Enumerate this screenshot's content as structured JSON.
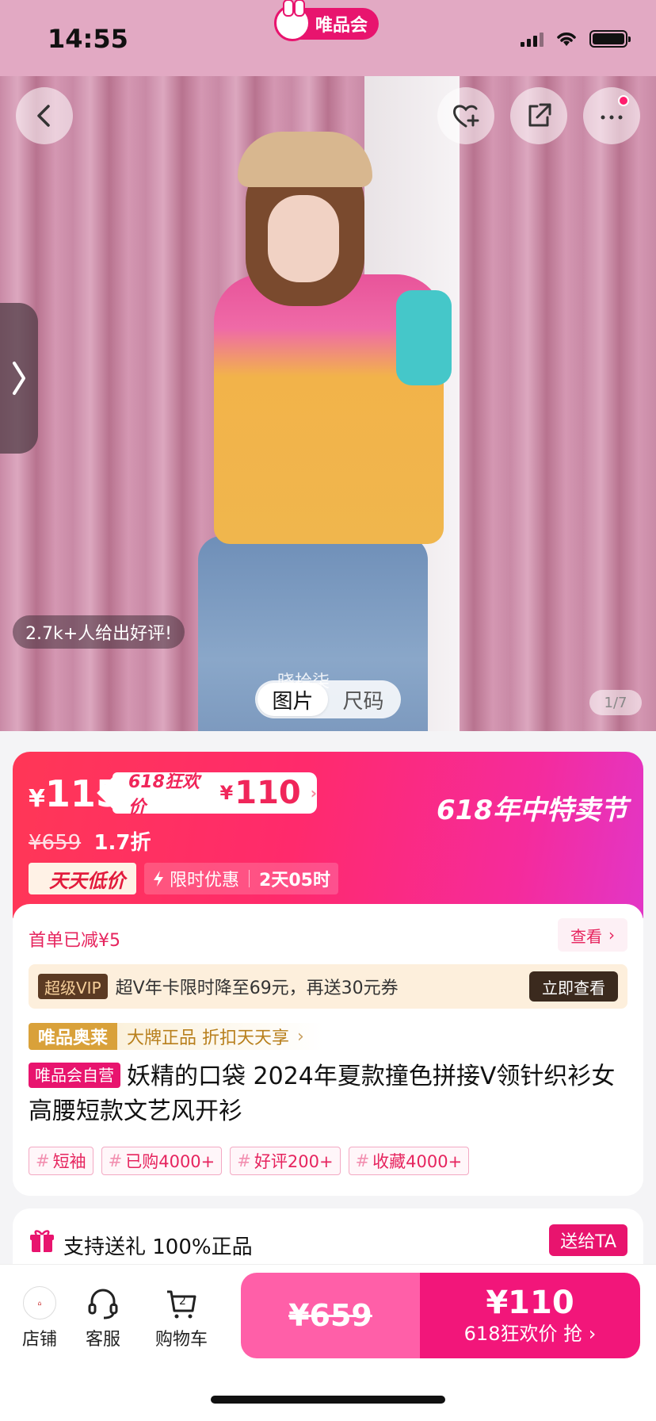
{
  "status": {
    "time": "14:55",
    "brand": "唯品会"
  },
  "hero": {
    "review": "2.7k+人给出好评!",
    "overlay": "晓拾柒",
    "tabs": [
      {
        "label": "图片"
      },
      {
        "label": "尺码"
      }
    ],
    "counter": "1/7"
  },
  "price": {
    "yen": "¥",
    "current": "115",
    "promo_label": "618狂欢价",
    "promo_yen": "¥",
    "promo_value": "110",
    "festival": "618年中特卖节",
    "original": "¥659",
    "discount": "1.7折",
    "daily_low": "天天低价",
    "limited_label": "限时优惠",
    "limited_time": "2天05时"
  },
  "offers": {
    "first_order": "首单已减¥5",
    "view_label": "查看",
    "svip_tag": "超级VIP",
    "svip_text": "超V年卡限时降至69元，再送30元券",
    "svip_button": "立即查看",
    "outlet_tag": "唯品奥莱",
    "outlet_slogan": "大牌正品 折扣天天享"
  },
  "product": {
    "self_tag": "唯品会自营",
    "title": "妖精的口袋 2024年夏款撞色拼接V领针织衫女高腰短款文艺风开衫",
    "chips": [
      {
        "label": "短袖"
      },
      {
        "label": "已购4000+"
      },
      {
        "label": "好评200+"
      },
      {
        "label": "收藏4000+"
      }
    ]
  },
  "gift": {
    "text": "支持送礼  100%正品",
    "button": "送给TA"
  },
  "bottom": {
    "store": "店铺",
    "service": "客服",
    "cart": "购物车",
    "cart_count": "2",
    "buy_original": "¥659",
    "buy_price": "¥110",
    "buy_label": "618狂欢价 抢",
    "buy_arrow": "›"
  },
  "colors": {
    "brand": "#e8146e",
    "banner_start": "#ff3756",
    "banner_end": "#e236c7"
  }
}
